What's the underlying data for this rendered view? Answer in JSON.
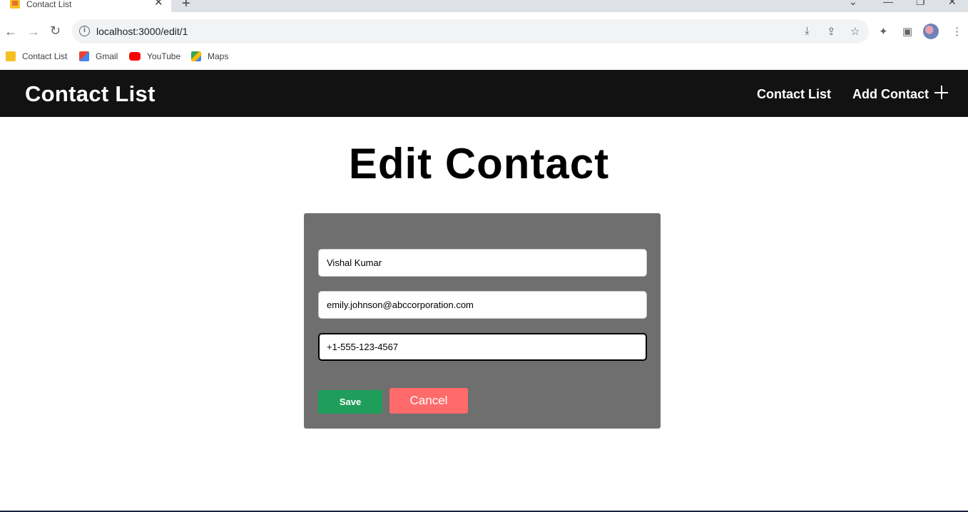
{
  "browser": {
    "tab_title": "Contact List",
    "tab_close": "✕",
    "new_tab": "+",
    "url": "localhost:3000/edit/1",
    "bookmarks": [
      {
        "label": "Contact List",
        "icon": "contact-list-favicon",
        "color": "#f5c023"
      },
      {
        "label": "Gmail",
        "icon": "gmail-icon",
        "color": "#ea4335"
      },
      {
        "label": "YouTube",
        "icon": "youtube-icon",
        "color": "#ff0000"
      },
      {
        "label": "Maps",
        "icon": "maps-icon",
        "color": "#34a853"
      }
    ]
  },
  "header": {
    "brand": "Contact List",
    "nav": {
      "contact_list": "Contact List",
      "add_contact": "Add Contact"
    }
  },
  "page": {
    "title": "Edit Contact"
  },
  "form": {
    "name_value": "Vishal Kumar",
    "email_value": "emily.johnson@abccorporation.com",
    "phone_value": "+1-555-123-4567",
    "save_label": "Save",
    "cancel_label": "Cancel"
  },
  "colors": {
    "header_bg": "#121212",
    "card_bg": "#6e6f6e",
    "save_bg": "#1e9e5a",
    "cancel_bg": "#ff6b6b"
  }
}
